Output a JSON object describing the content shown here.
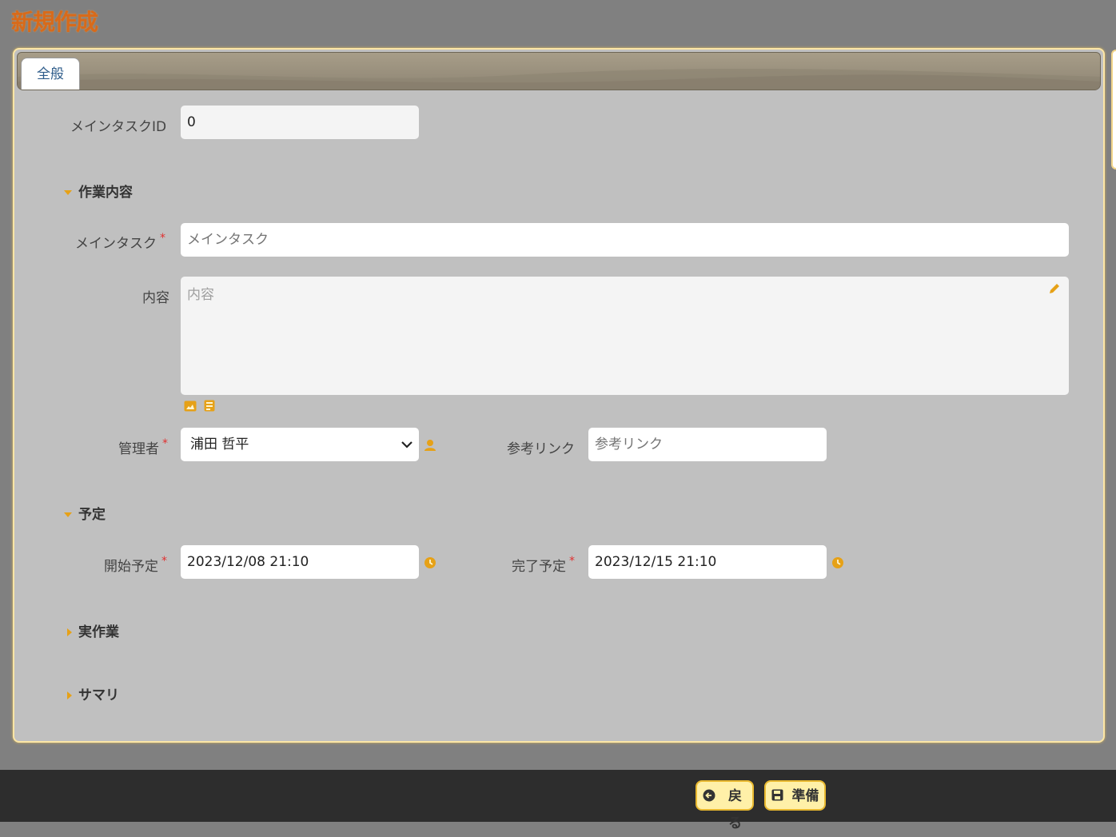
{
  "page": {
    "title": "新規作成"
  },
  "tabs": [
    {
      "label": "全般"
    }
  ],
  "form": {
    "main_task_id": {
      "label": "メインタスクID",
      "value": "0"
    },
    "sections": {
      "work": "作業内容",
      "schedule": "予定",
      "actual": "実作業",
      "summary": "サマリ"
    },
    "main_task": {
      "label": "メインタスク",
      "placeholder": "メインタスク",
      "required_mark": "*"
    },
    "content": {
      "label": "内容",
      "placeholder": "内容"
    },
    "manager": {
      "label": "管理者",
      "value": "浦田 哲平",
      "required_mark": "*"
    },
    "ref_link": {
      "label": "参考リンク",
      "placeholder": "参考リンク"
    },
    "start": {
      "label": "開始予定",
      "value": "2023/12/08 21:10",
      "required_mark": "*"
    },
    "end": {
      "label": "完了予定",
      "value": "2023/12/15 21:10",
      "required_mark": "*"
    }
  },
  "footer": {
    "back_label": "戻る",
    "prepare_label": "準備"
  },
  "colors": {
    "accent": "#e6a117",
    "title": "#d86a1a",
    "required": "#e03030"
  },
  "icons": [
    "pencil-icon",
    "image-icon",
    "file-icon",
    "user-icon",
    "clock-icon",
    "back-arrow-icon",
    "save-icon"
  ]
}
